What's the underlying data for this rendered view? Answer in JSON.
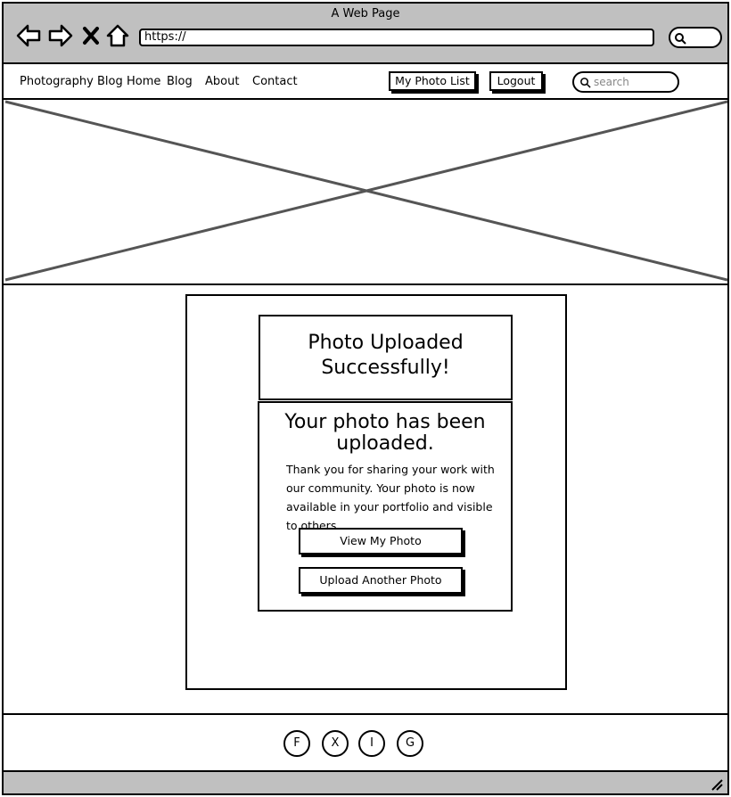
{
  "window": {
    "title": "A Web Page"
  },
  "browser": {
    "url": "https://",
    "back_icon": "arrow-left-icon",
    "forward_icon": "arrow-right-icon",
    "stop_icon": "close-icon",
    "home_icon": "home-icon",
    "search_icon": "search-icon"
  },
  "navbar": {
    "brand": "Photography Blog",
    "links": [
      "Home",
      "Blog",
      "About",
      "Contact"
    ],
    "my_photo_list": "My Photo List",
    "logout": "Logout",
    "search_placeholder": "search"
  },
  "hero": {
    "image": "image-placeholder"
  },
  "content": {
    "title": "Photo Uploaded Successfully!",
    "heading": "Your photo has been uploaded.",
    "message": "Thank you for sharing your work with our community. Your photo is now available in your portfolio and visible to others.",
    "view_button": "View My Photo",
    "upload_button": "Upload Another Photo"
  },
  "footer": {
    "social": [
      "F",
      "X",
      "I",
      "G"
    ]
  }
}
